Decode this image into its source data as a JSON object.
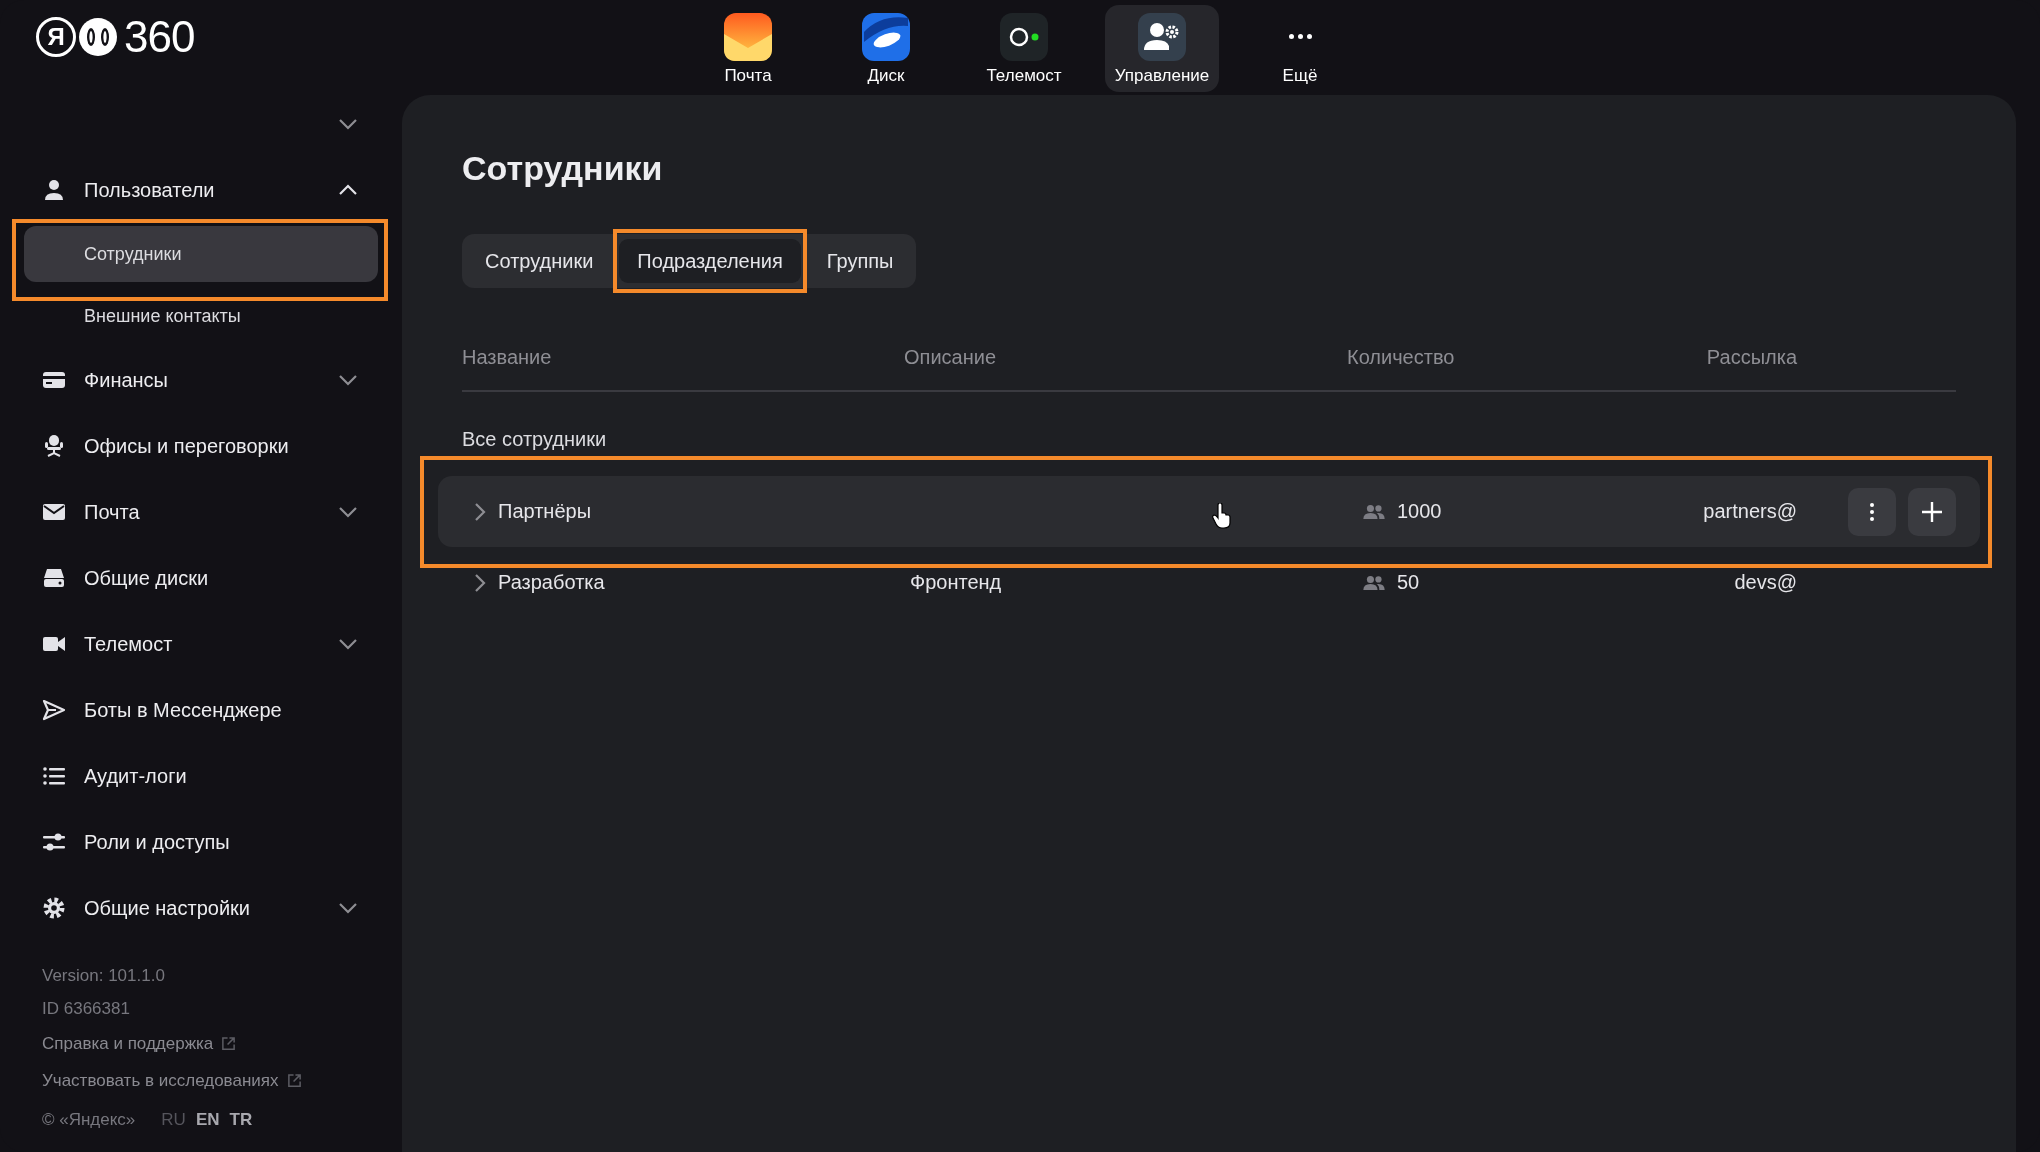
{
  "logo": {
    "letter": "Я",
    "text": "360"
  },
  "apps": [
    {
      "kind": "mail",
      "label": "Почта",
      "selected": false
    },
    {
      "kind": "disk",
      "label": "Диск",
      "selected": false
    },
    {
      "kind": "telemost",
      "label": "Телемост",
      "selected": false
    },
    {
      "kind": "admin",
      "label": "Управление",
      "selected": true
    },
    {
      "kind": "more",
      "label": "Ещё",
      "selected": false
    }
  ],
  "sidebar": {
    "items": [
      {
        "kind": "user",
        "label": "Пользователи",
        "expanded": true,
        "children": [
          {
            "label": "Сотрудники",
            "selected": true,
            "highlighted": true
          },
          {
            "label": "Внешние контакты",
            "selected": false,
            "highlighted": false
          }
        ]
      },
      {
        "kind": "card",
        "label": "Финансы",
        "expanded": false
      },
      {
        "kind": "chair",
        "label": "Офисы и переговорки"
      },
      {
        "kind": "mail",
        "label": "Почта",
        "expanded": false
      },
      {
        "kind": "drive",
        "label": "Общие диски"
      },
      {
        "kind": "video",
        "label": "Телемост",
        "expanded": false
      },
      {
        "kind": "send",
        "label": "Боты в Мессенджере"
      },
      {
        "kind": "list",
        "label": "Аудит-логи"
      },
      {
        "kind": "sliders",
        "label": "Роли и доступы"
      },
      {
        "kind": "gear",
        "label": "Общие настройки",
        "expanded": false
      }
    ],
    "footer": {
      "version": "Version: 101.1.0",
      "id": "ID 6366381",
      "links": [
        {
          "label": "Справка и поддержка"
        },
        {
          "label": "Участвовать в исследованиях"
        }
      ],
      "copyright": "© «Яндекс»",
      "languages": [
        {
          "label": "RU",
          "selected": true
        },
        {
          "label": "EN",
          "selected": false
        },
        {
          "label": "TR",
          "selected": false
        }
      ]
    }
  },
  "main": {
    "title": "Сотрудники",
    "tabs": [
      {
        "label": "Сотрудники",
        "selected": false,
        "highlighted": false
      },
      {
        "label": "Подразделения",
        "selected": true,
        "highlighted": true
      },
      {
        "label": "Группы",
        "selected": false,
        "highlighted": false
      }
    ],
    "table": {
      "columns": [
        "Название",
        "Описание",
        "Количество",
        "Рассылка"
      ],
      "group_label": "Все сотрудники",
      "rows": [
        {
          "name": "Партнёры",
          "description": "",
          "count": "1000",
          "mailing": "partners@",
          "hovered": true,
          "highlighted": true
        },
        {
          "name": "Разработка",
          "description": "Фронтенд",
          "count": "50",
          "mailing": "devs@",
          "hovered": false,
          "highlighted": false
        }
      ]
    }
  }
}
